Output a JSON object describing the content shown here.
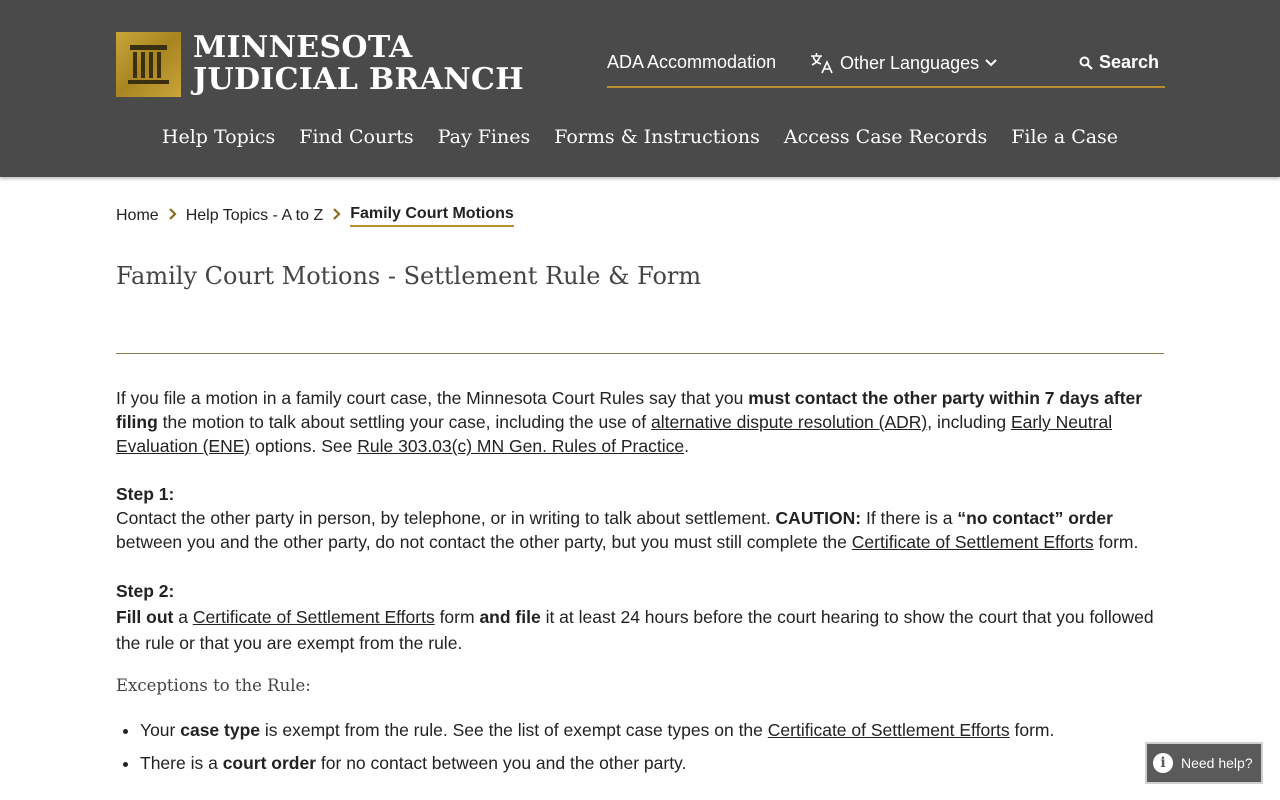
{
  "header": {
    "logo_line1": "MINNESOTA",
    "logo_line2": "JUDICIAL BRANCH",
    "ada": "ADA Accommodation",
    "languages": "Other Languages",
    "search": "Search",
    "nav": [
      "Help Topics",
      "Find Courts",
      "Pay Fines",
      "Forms & Instructions",
      "Access Case Records",
      "File a Case"
    ]
  },
  "breadcrumb": {
    "home": "Home",
    "topics": "Help Topics - A to Z",
    "current": "Family Court Motions"
  },
  "page": {
    "title": "Family Court Motions - Settlement Rule & Form",
    "intro": {
      "t1": "If you file a motion in a family court case, the Minnesota Court Rules say that you ",
      "b1": "must contact the other party within 7 days after filing",
      "t2": " the motion to talk about settling your case, including the use of ",
      "l1": "alternative dispute resolution (ADR)",
      "t3": ", including ",
      "l2": "Early Neutral Evaluation (ENE)",
      "t4": " options. See ",
      "l3": "Rule 303.03(c) MN Gen. Rules of Practice",
      "t5": "."
    },
    "step1": {
      "heading": "Step 1:",
      "t1": "Contact the other party in person, by telephone, or in writing to talk about settlement. ",
      "b1": "CAUTION:",
      "t2": " If there is a ",
      "b2": "“no contact” order",
      "t3": " between you and the other party, do not contact the other party, but you must still complete the ",
      "l1": "Certificate of Settlement Efforts",
      "t4": " form."
    },
    "step2": {
      "heading": "Step 2:",
      "b1": "Fill out",
      "t1": " a ",
      "l1": "Certificate of Settlement Efforts",
      "t2": " form ",
      "b2": "and file",
      "t3": " it at least 24 hours before the court hearing to show the court that you followed the rule or that you are exempt from the rule."
    },
    "exceptions_heading": "Exceptions to the Rule:",
    "bullet1": {
      "t1": "Your ",
      "b1": "case type",
      "t2": " is exempt from the rule. See the list of exempt case types on the ",
      "l1": "Certificate of Settlement Efforts",
      "t3": " form."
    },
    "bullet2": {
      "t1": "There is a ",
      "b1": "court order",
      "t2": " for no contact between you and the other party."
    }
  },
  "help_button": "Need help?"
}
